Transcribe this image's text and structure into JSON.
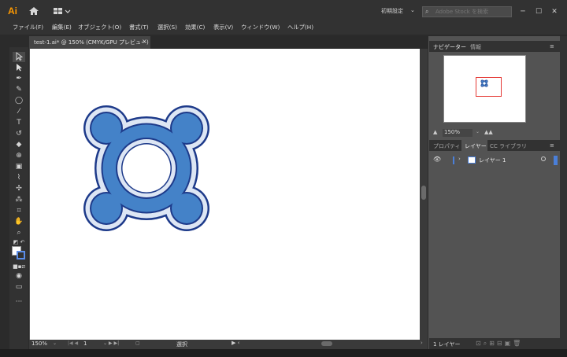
{
  "app": {
    "logo": "Ai",
    "preset_label": "初期設定",
    "search_placeholder": "Adobe Stock を検索"
  },
  "menu": [
    "ファイル(F)",
    "編集(E)",
    "オブジェクト(O)",
    "書式(T)",
    "選択(S)",
    "効果(C)",
    "表示(V)",
    "ウィンドウ(W)",
    "ヘルプ(H)"
  ],
  "document_tab": {
    "title": "test-1.ai* @ 150% (CMYK/GPU プレビュー)",
    "close": "×"
  },
  "status": {
    "zoom": "150%",
    "page": "1",
    "tool_status": "選択"
  },
  "navigator": {
    "tab_navigator": "ナビゲーター",
    "tab_info": "情報",
    "zoom": "150%"
  },
  "layers_panel": {
    "tab_properties": "プロパティ",
    "tab_layers": "レイヤー",
    "tab_libraries": "CC ライブラリ",
    "layer_name": "レイヤー 1",
    "layer_count": "1 レイヤー"
  },
  "colors": {
    "shape_fill": "#4482c8",
    "shape_stroke": "#1d3a8a",
    "inner_outline": "#dde6f4",
    "nav_highlight": "#e53935",
    "layer_color": "#4a7fd9"
  },
  "icons": {
    "home": "home-icon",
    "search": "search-icon",
    "visibility": "eye-icon"
  }
}
